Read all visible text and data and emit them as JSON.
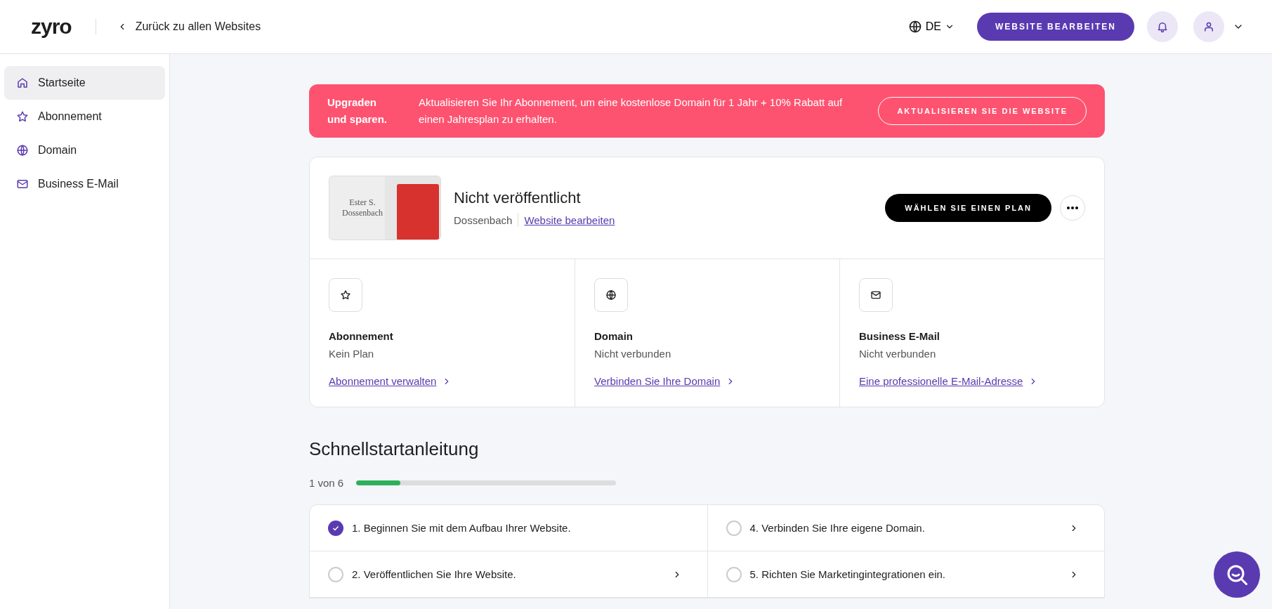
{
  "header": {
    "logo": "zyro",
    "back_link": "Zurück zu allen Websites",
    "language": "DE",
    "edit_button": "WEBSITE BEARBEITEN"
  },
  "sidebar": {
    "items": [
      {
        "label": "Startseite",
        "kind": "home",
        "selected": true
      },
      {
        "label": "Abonnement",
        "kind": "star",
        "selected": false
      },
      {
        "label": "Domain",
        "kind": "globe",
        "selected": false
      },
      {
        "label": "Business E-Mail",
        "kind": "mail",
        "selected": false
      }
    ]
  },
  "banner": {
    "title": "Upgraden und sparen.",
    "text": "Aktualisieren Sie Ihr Abonnement, um eine kostenlose Domain für 1 Jahr + 10% Rabatt auf einen Jahresplan zu erhalten.",
    "button": "AKTUALISIEREN SIE DIE WEBSITE"
  },
  "site": {
    "thumbnail_title": "Ester S. Dossenbach",
    "status": "Nicht veröffentlicht",
    "name": "Dossenbach",
    "edit_link": "Website bearbeiten",
    "plan_button": "WÄHLEN SIE EINEN PLAN"
  },
  "services": [
    {
      "kind": "star",
      "title": "Abonnement",
      "status": "Kein Plan",
      "link": "Abonnement verwalten"
    },
    {
      "kind": "globe",
      "title": "Domain",
      "status": "Nicht verbunden",
      "link": "Verbinden Sie Ihre Domain"
    },
    {
      "kind": "mail",
      "title": "Business E-Mail",
      "status": "Nicht verbunden",
      "link": "Eine professionelle E-Mail-Adresse"
    }
  ],
  "quickstart": {
    "title": "Schnellstartanleitung",
    "progress_text": "1 von 6",
    "level": 0.17,
    "tasks": [
      {
        "label": "1. Beginnen Sie mit dem Aufbau Ihrer Website.",
        "checked": true
      },
      {
        "label": "4. Verbinden Sie Ihre eigene Domain.",
        "checked": false
      },
      {
        "label": "2. Veröffentlichen Sie Ihre Website.",
        "checked": false
      },
      {
        "label": "5. Richten Sie Marketingintegrationen ein.",
        "checked": false
      }
    ]
  }
}
